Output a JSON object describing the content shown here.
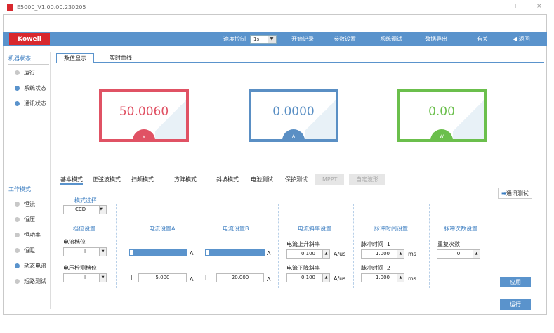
{
  "window": {
    "title": "E5000_V1.00.00.230205",
    "min": "□",
    "close": "×"
  },
  "toolbar": {
    "brand": "Kowell",
    "speed_label": "速度控制",
    "speed_value": "1s",
    "start_record": "开始记录",
    "params": "参数设置",
    "system_debug": "系统调试",
    "data_export": "数据导出",
    "about": "有关",
    "back": "返回"
  },
  "sidebar": {
    "status_head": "机器状态",
    "status_items": [
      "运行",
      "系统状态",
      "通讯状态"
    ],
    "mode_head": "工作模式",
    "mode_items": [
      "恒流",
      "恒压",
      "恒功率",
      "恒阻",
      "动态电流",
      "短路测试"
    ]
  },
  "tabs": [
    "数值显示",
    "实时曲线"
  ],
  "gauges": [
    {
      "value": "50.0060",
      "unit": "V",
      "color": "#e05264"
    },
    {
      "value": "0.0000",
      "unit": "A",
      "color": "#5a8fc4"
    },
    {
      "value": "0.00",
      "unit": "W",
      "color": "#6bbf4c"
    }
  ],
  "modes": [
    "基本模式",
    "正弦波模式",
    "扫频模式",
    "方阵模式",
    "斜坡模式",
    "电池测试",
    "保护测试",
    "MPPT",
    "自定波形"
  ],
  "serial_btn": "通讯测试",
  "form": {
    "mode_select_label": "模式选择",
    "mode_select_value": "CCD",
    "range_title": "档位设置",
    "current_range_label": "电流档位",
    "current_range_value": "II",
    "voltage_range_label": "电压检测档位",
    "voltage_range_value": "II",
    "currentA_title": "电流设置A",
    "currentA_value": "5.000",
    "currentB_title": "电流设置B",
    "currentB_value": "20.000",
    "slope_title": "电流斜率设置",
    "rise_label": "电流上升斜率",
    "rise_value": "0.100",
    "fall_label": "电流下降斜率",
    "fall_value": "0.100",
    "pulse_title": "脉冲时间设置",
    "t1_label": "脉冲时间T1",
    "t1_value": "1.000",
    "t2_label": "脉冲时间T2",
    "t2_value": "1.000",
    "cycle_title": "脉冲次数设置",
    "count_label": "重复次数",
    "count_value": "0",
    "unit_A": "A",
    "unit_Aus": "A/us",
    "unit_ms": "ms",
    "low": "I"
  },
  "apply_btn": "应用",
  "run_btn": "运行"
}
